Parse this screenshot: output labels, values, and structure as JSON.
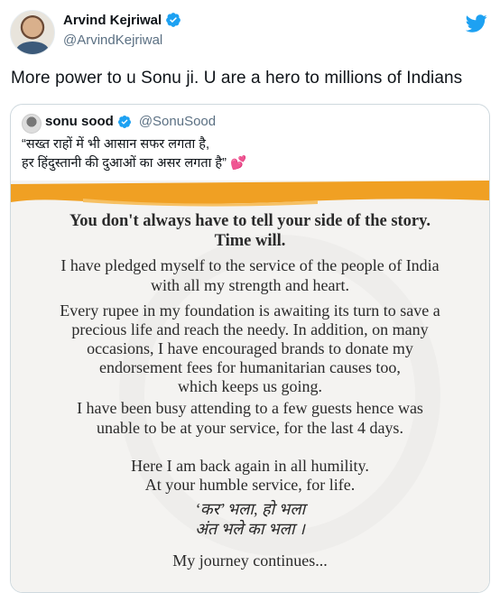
{
  "author": {
    "display_name": "Arvind Kejriwal",
    "handle": "@ArvindKejriwal",
    "verified_icon": "verified-badge-icon",
    "brand_icon": "twitter-bird-icon"
  },
  "tweet": {
    "text": "More power to u Sonu ji. U are a hero to millions of Indians"
  },
  "quoted_tweet": {
    "display_name": "sonu sood",
    "handle": "@SonuSood",
    "text_line1": "“सख्त राहों में भी आसान सफर लगता है,",
    "text_line2": "हर हिंदुस्तानी की दुआओं का असर लगता है”",
    "emoji": "💕",
    "image": {
      "lead": "You don't always have to tell your side of the story.\nTime will.",
      "p1": "I have pledged myself to the service of the people of India\nwith all my strength and heart.",
      "p2": "Every rupee in my foundation is awaiting its turn to save a\nprecious life and reach the needy. In addition, on many\noccasions, I have encouraged brands to donate my\nendorsement fees for humanitarian causes too,\nwhich keeps us going.",
      "p3": "I have been busy attending to a few guests hence was\nunable to be at your service, for the last 4 days.",
      "p4": "Here I am back again in all humility.\nAt your humble service, for life.",
      "hindi": "‘कर’ भला, हो भला\nअंत भले का भला ।",
      "closing": "My journey continues..."
    }
  },
  "colors": {
    "accent": "#1da1f2",
    "brush": "#f0a023",
    "text": "#0f1419",
    "muted": "#5b7083"
  }
}
